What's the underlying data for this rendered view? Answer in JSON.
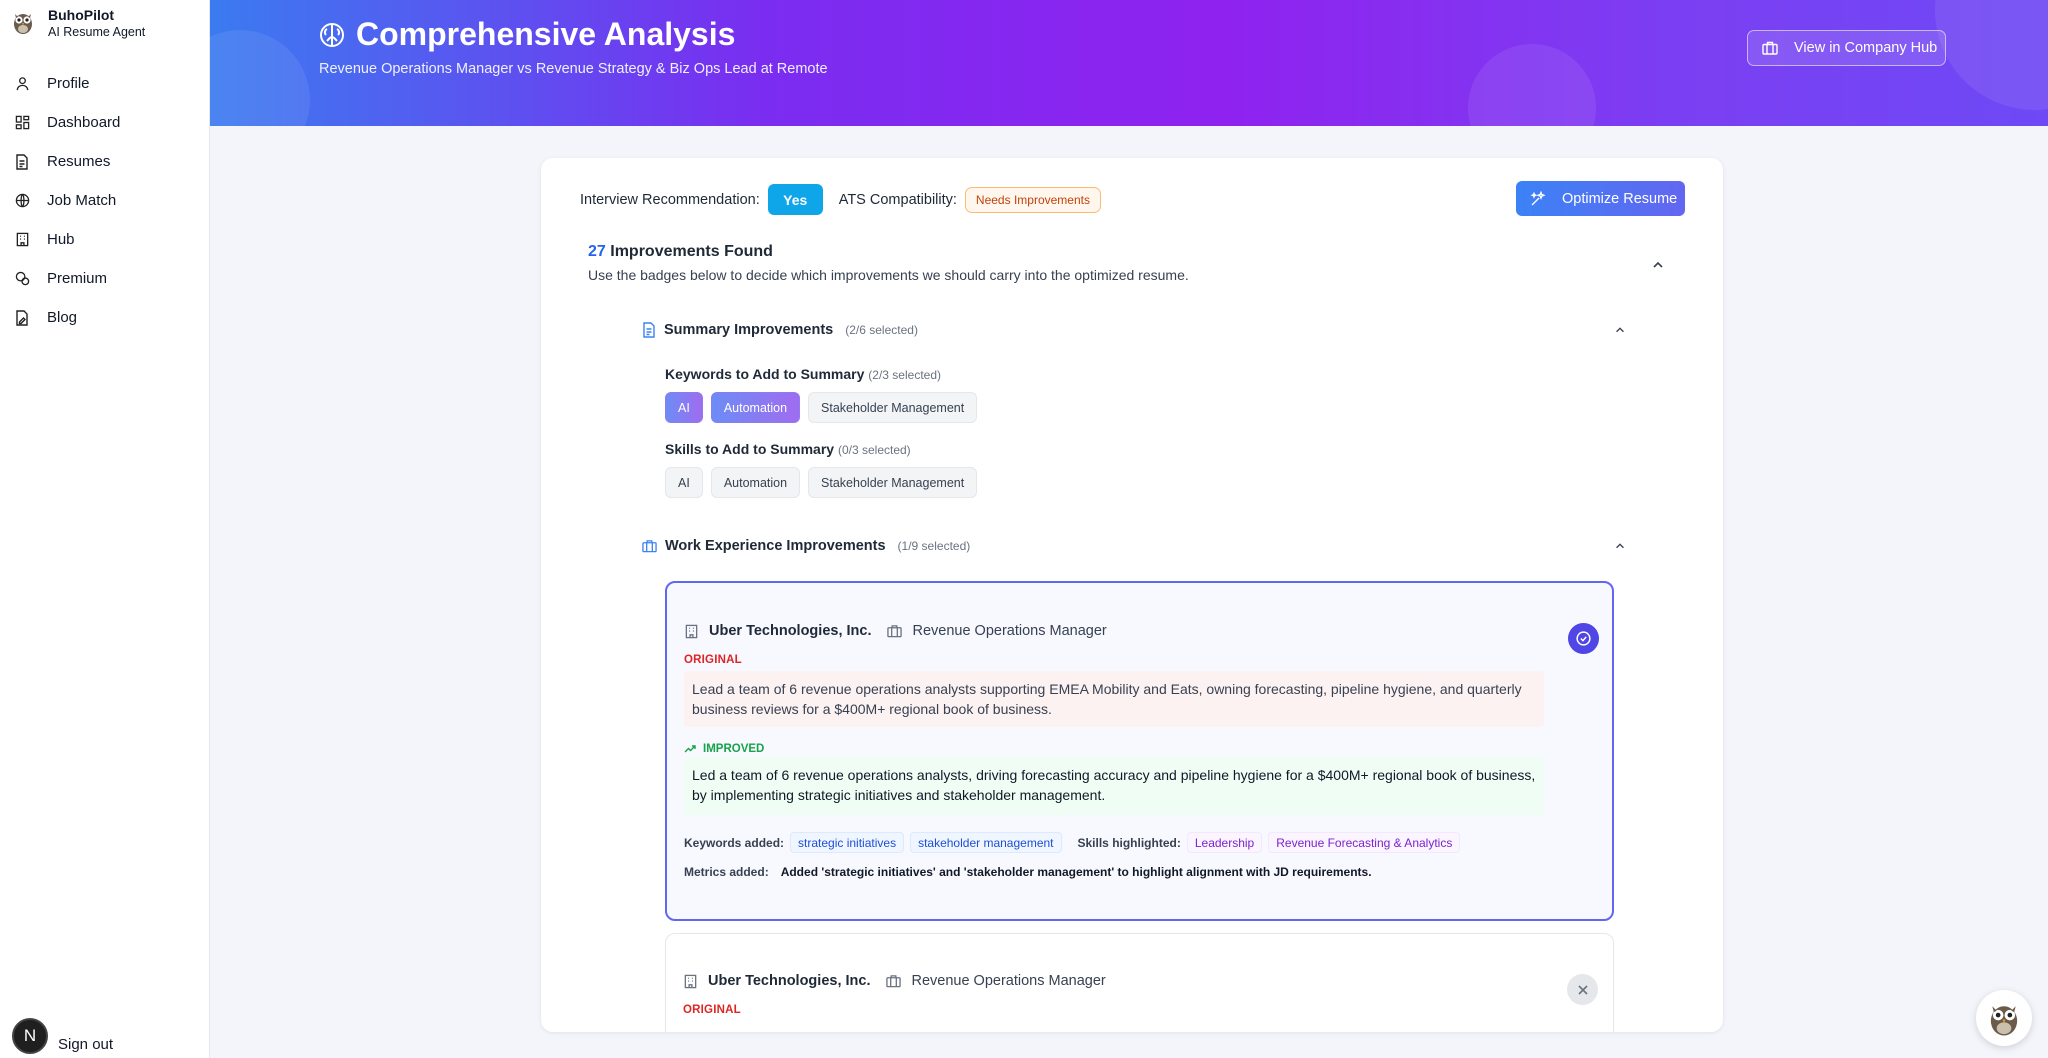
{
  "brand": {
    "name": "BuhoPilot",
    "subtitle": "AI Resume Agent"
  },
  "nav": [
    {
      "label": "Profile",
      "icon": "user-icon"
    },
    {
      "label": "Dashboard",
      "icon": "dashboard-icon"
    },
    {
      "label": "Resumes",
      "icon": "document-icon"
    },
    {
      "label": "Job Match",
      "icon": "globe-icon"
    },
    {
      "label": "Hub",
      "icon": "building-icon"
    },
    {
      "label": "Premium",
      "icon": "premium-icon"
    },
    {
      "label": "Blog",
      "icon": "blog-icon"
    }
  ],
  "signout": {
    "avatar_letter": "N",
    "label": "Sign out"
  },
  "header": {
    "title": "Comprehensive Analysis",
    "subtitle": "Revenue Operations Manager vs Revenue Strategy & Biz Ops Lead at Remote",
    "hub_button": "View in Company Hub"
  },
  "analysis": {
    "interview_label": "Interview Recommendation:",
    "interview_value": "Yes",
    "ats_label": "ATS Compatibility:",
    "ats_value": "Needs Improvements",
    "optimize_button": "Optimize Resume",
    "improvements_count": "27",
    "improvements_title": "Improvements Found",
    "improvements_desc": "Use the badges below to decide which improvements we should carry into the optimized resume."
  },
  "summary_section": {
    "title": "Summary Improvements",
    "selected": "(2/6 selected)",
    "keywords": {
      "title": "Keywords to Add to Summary",
      "selected": "(2/3 selected)",
      "chips": [
        "AI",
        "Automation",
        "Stakeholder Management"
      ]
    },
    "skills": {
      "title": "Skills to Add to Summary",
      "selected": "(0/3 selected)",
      "chips": [
        "AI",
        "Automation",
        "Stakeholder Management"
      ]
    }
  },
  "work_section": {
    "title": "Work Experience Improvements",
    "selected": "(1/9 selected)",
    "items": [
      {
        "company": "Uber Technologies, Inc.",
        "role": "Revenue Operations Manager",
        "original_label": "ORIGINAL",
        "original": "Lead a team of 6 revenue operations analysts supporting EMEA Mobility and Eats, owning forecasting, pipeline hygiene, and quarterly business reviews for a $400M+ regional book of business.",
        "improved_label": "IMPROVED",
        "improved": "Led a team of 6 revenue operations analysts, driving forecasting accuracy and pipeline hygiene for a $400M+ regional book of business, by implementing strategic initiatives and stakeholder management.",
        "keywords_label": "Keywords added:",
        "keywords": [
          "strategic initiatives",
          "stakeholder management"
        ],
        "skills_label": "Skills highlighted:",
        "skills": [
          "Leadership",
          "Revenue Forecasting & Analytics"
        ],
        "metrics_label": "Metrics added:",
        "metrics": "Added 'strategic initiatives' and 'stakeholder management' to highlight alignment with JD requirements."
      },
      {
        "company": "Uber Technologies, Inc.",
        "role": "Revenue Operations Manager",
        "original_label": "ORIGINAL"
      }
    ]
  },
  "colors": {
    "accent": "#6366f1",
    "yes": "#0ea5e9",
    "original": "#dc2626",
    "improved": "#16a34a"
  }
}
